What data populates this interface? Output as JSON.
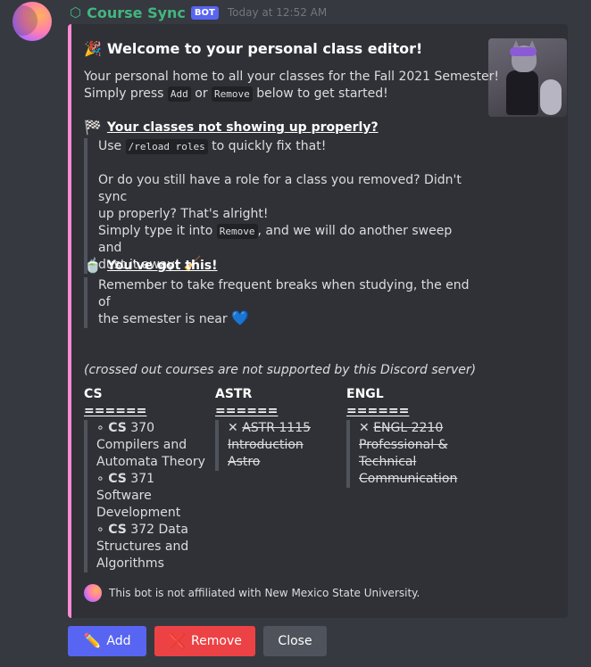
{
  "header": {
    "username": "Course Sync",
    "bot_tag": "BOT",
    "timestamp": "Today at 12:52 AM"
  },
  "embed": {
    "title": "Welcome to your personal class editor!",
    "title_icon": "🎉",
    "intro_line1": "Your personal home to all your classes for the Fall 2021 Semester!",
    "intro_simply": "Simply press",
    "intro_add": "Add",
    "intro_or": "or",
    "intro_remove": "Remove",
    "intro_tail": "below to get started!",
    "section1": {
      "icon": "🏁",
      "title": "Your classes not showing up properly?",
      "use": "Use",
      "cmd": "/reload roles",
      "tail": "to quickly fix that!",
      "line_q1": "Or do you still have a role for a class you removed? Didn't sync",
      "line_q2": "up properly? That's alright!",
      "line_s1_pre": "Simply type it into",
      "line_s1_code": "Remove",
      "line_s1_post": ", and we will do another sweep and",
      "line_s2": "dust it away!",
      "broom": "🧹"
    },
    "section2": {
      "icon": "🍵",
      "title": "You've got this!",
      "line1": "Remember to take frequent breaks when studying, the end of",
      "line2": "the semester is near",
      "heart": "💙"
    },
    "note": "(crossed out courses are not supported by this Discord server)",
    "fields": [
      {
        "name": "CS",
        "rule": "======",
        "lines": [
          {
            "bullet": "∘",
            "code": "CS",
            "text": " 370"
          },
          {
            "text": "Compilers and"
          },
          {
            "text": "Automata Theory"
          },
          {
            "bullet": "∘",
            "code": "CS",
            "text": " 371"
          },
          {
            "text": "Software"
          },
          {
            "text": "Development"
          },
          {
            "bullet": "∘",
            "code": "CS",
            "text": " 372 Data"
          },
          {
            "text": "Structures and"
          },
          {
            "text": "Algorithms"
          }
        ]
      },
      {
        "name": "ASTR",
        "rule": "======",
        "x_mark": "✕",
        "lines": [
          {
            "text": "ASTR 1115"
          },
          {
            "text": "Introduction"
          },
          {
            "text": "Astro"
          }
        ]
      },
      {
        "name": "ENGL",
        "rule": "======",
        "x_mark": "✕",
        "lines": [
          {
            "text": "ENGL 2210"
          },
          {
            "text": "Professional &"
          },
          {
            "text": "Technical"
          },
          {
            "text": "Communication"
          }
        ]
      }
    ],
    "footer": "This bot is not affiliated with New Mexico State University."
  },
  "buttons": {
    "add": {
      "label": "Add",
      "icon": "✏️"
    },
    "remove": {
      "label": "Remove",
      "icon": "❌"
    },
    "close": {
      "label": "Close"
    }
  },
  "colors": {
    "embed_accent": "#ff8bd6",
    "blurple": "#5865f2",
    "red": "#ed4245",
    "grey": "#4f545c",
    "username": "#43b581"
  }
}
